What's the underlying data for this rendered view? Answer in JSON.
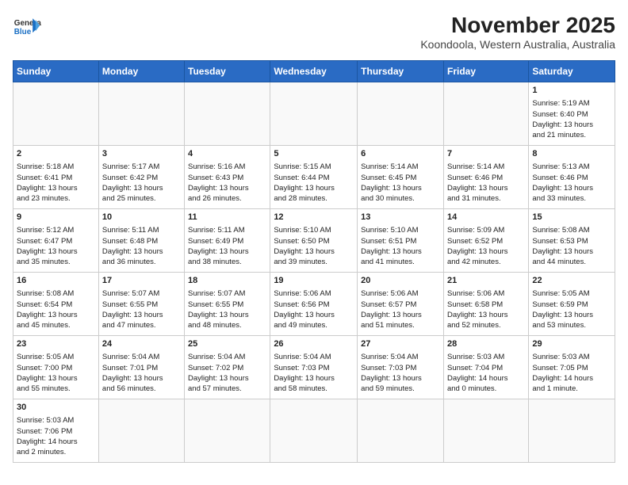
{
  "header": {
    "title": "November 2025",
    "subtitle": "Koondoola, Western Australia, Australia",
    "logo_line1": "General",
    "logo_line2": "Blue"
  },
  "days_of_week": [
    "Sunday",
    "Monday",
    "Tuesday",
    "Wednesday",
    "Thursday",
    "Friday",
    "Saturday"
  ],
  "weeks": [
    [
      {
        "day": "",
        "content": ""
      },
      {
        "day": "",
        "content": ""
      },
      {
        "day": "",
        "content": ""
      },
      {
        "day": "",
        "content": ""
      },
      {
        "day": "",
        "content": ""
      },
      {
        "day": "",
        "content": ""
      },
      {
        "day": "1",
        "content": "Sunrise: 5:19 AM\nSunset: 6:40 PM\nDaylight: 13 hours\nand 21 minutes."
      }
    ],
    [
      {
        "day": "2",
        "content": "Sunrise: 5:18 AM\nSunset: 6:41 PM\nDaylight: 13 hours\nand 23 minutes."
      },
      {
        "day": "3",
        "content": "Sunrise: 5:17 AM\nSunset: 6:42 PM\nDaylight: 13 hours\nand 25 minutes."
      },
      {
        "day": "4",
        "content": "Sunrise: 5:16 AM\nSunset: 6:43 PM\nDaylight: 13 hours\nand 26 minutes."
      },
      {
        "day": "5",
        "content": "Sunrise: 5:15 AM\nSunset: 6:44 PM\nDaylight: 13 hours\nand 28 minutes."
      },
      {
        "day": "6",
        "content": "Sunrise: 5:14 AM\nSunset: 6:45 PM\nDaylight: 13 hours\nand 30 minutes."
      },
      {
        "day": "7",
        "content": "Sunrise: 5:14 AM\nSunset: 6:46 PM\nDaylight: 13 hours\nand 31 minutes."
      },
      {
        "day": "8",
        "content": "Sunrise: 5:13 AM\nSunset: 6:46 PM\nDaylight: 13 hours\nand 33 minutes."
      }
    ],
    [
      {
        "day": "9",
        "content": "Sunrise: 5:12 AM\nSunset: 6:47 PM\nDaylight: 13 hours\nand 35 minutes."
      },
      {
        "day": "10",
        "content": "Sunrise: 5:11 AM\nSunset: 6:48 PM\nDaylight: 13 hours\nand 36 minutes."
      },
      {
        "day": "11",
        "content": "Sunrise: 5:11 AM\nSunset: 6:49 PM\nDaylight: 13 hours\nand 38 minutes."
      },
      {
        "day": "12",
        "content": "Sunrise: 5:10 AM\nSunset: 6:50 PM\nDaylight: 13 hours\nand 39 minutes."
      },
      {
        "day": "13",
        "content": "Sunrise: 5:10 AM\nSunset: 6:51 PM\nDaylight: 13 hours\nand 41 minutes."
      },
      {
        "day": "14",
        "content": "Sunrise: 5:09 AM\nSunset: 6:52 PM\nDaylight: 13 hours\nand 42 minutes."
      },
      {
        "day": "15",
        "content": "Sunrise: 5:08 AM\nSunset: 6:53 PM\nDaylight: 13 hours\nand 44 minutes."
      }
    ],
    [
      {
        "day": "16",
        "content": "Sunrise: 5:08 AM\nSunset: 6:54 PM\nDaylight: 13 hours\nand 45 minutes."
      },
      {
        "day": "17",
        "content": "Sunrise: 5:07 AM\nSunset: 6:55 PM\nDaylight: 13 hours\nand 47 minutes."
      },
      {
        "day": "18",
        "content": "Sunrise: 5:07 AM\nSunset: 6:55 PM\nDaylight: 13 hours\nand 48 minutes."
      },
      {
        "day": "19",
        "content": "Sunrise: 5:06 AM\nSunset: 6:56 PM\nDaylight: 13 hours\nand 49 minutes."
      },
      {
        "day": "20",
        "content": "Sunrise: 5:06 AM\nSunset: 6:57 PM\nDaylight: 13 hours\nand 51 minutes."
      },
      {
        "day": "21",
        "content": "Sunrise: 5:06 AM\nSunset: 6:58 PM\nDaylight: 13 hours\nand 52 minutes."
      },
      {
        "day": "22",
        "content": "Sunrise: 5:05 AM\nSunset: 6:59 PM\nDaylight: 13 hours\nand 53 minutes."
      }
    ],
    [
      {
        "day": "23",
        "content": "Sunrise: 5:05 AM\nSunset: 7:00 PM\nDaylight: 13 hours\nand 55 minutes."
      },
      {
        "day": "24",
        "content": "Sunrise: 5:04 AM\nSunset: 7:01 PM\nDaylight: 13 hours\nand 56 minutes."
      },
      {
        "day": "25",
        "content": "Sunrise: 5:04 AM\nSunset: 7:02 PM\nDaylight: 13 hours\nand 57 minutes."
      },
      {
        "day": "26",
        "content": "Sunrise: 5:04 AM\nSunset: 7:03 PM\nDaylight: 13 hours\nand 58 minutes."
      },
      {
        "day": "27",
        "content": "Sunrise: 5:04 AM\nSunset: 7:03 PM\nDaylight: 13 hours\nand 59 minutes."
      },
      {
        "day": "28",
        "content": "Sunrise: 5:03 AM\nSunset: 7:04 PM\nDaylight: 14 hours\nand 0 minutes."
      },
      {
        "day": "29",
        "content": "Sunrise: 5:03 AM\nSunset: 7:05 PM\nDaylight: 14 hours\nand 1 minute."
      }
    ],
    [
      {
        "day": "30",
        "content": "Sunrise: 5:03 AM\nSunset: 7:06 PM\nDaylight: 14 hours\nand 2 minutes."
      },
      {
        "day": "",
        "content": ""
      },
      {
        "day": "",
        "content": ""
      },
      {
        "day": "",
        "content": ""
      },
      {
        "day": "",
        "content": ""
      },
      {
        "day": "",
        "content": ""
      },
      {
        "day": "",
        "content": ""
      }
    ]
  ]
}
